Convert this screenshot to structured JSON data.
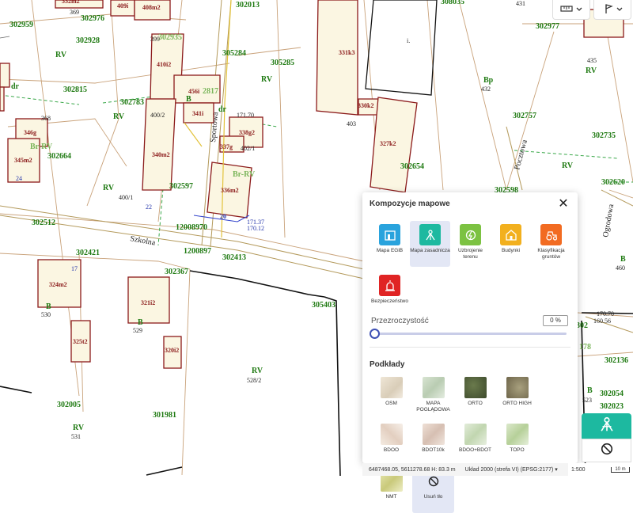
{
  "map": {
    "parcels": [
      "332m2",
      "409i",
      "408m2",
      "369",
      "302976",
      "302959",
      "302928",
      "399",
      "302935",
      "RV",
      "410i2",
      "302815",
      "302783",
      "456i",
      "2817",
      "341i",
      "400/2",
      "RV",
      "dr",
      "346g",
      "368",
      "Br-RV",
      "302664",
      "345m2",
      "340m2",
      "24",
      "RV",
      "400/1",
      "302597",
      "22",
      "302512",
      "12008970",
      "302421",
      "1200897",
      "302367",
      "324m2",
      "17",
      "321i2",
      "B",
      "B",
      "530",
      "529",
      "325t2",
      "320i2",
      "302005",
      "RV",
      "531",
      "301981",
      "RV",
      "528/2",
      "302413",
      "305403",
      "302013",
      "305284",
      "305285",
      "RV",
      "331k3",
      "i.",
      "330k2",
      "403",
      "327k2",
      "302654",
      "171.70",
      "338g2",
      "337g",
      "402/1",
      "336m2",
      "20",
      "Br-RV",
      "171.37",
      "170.12",
      "308035",
      "431",
      "302977",
      "435",
      "RV",
      "Bp",
      "432",
      "302757",
      "302735",
      "RV",
      "302598",
      "302620",
      "Ogrodowa",
      "Pocztowa",
      "B",
      "460",
      "170.70",
      "160.56",
      "302136",
      "302054",
      "302023",
      "B",
      "523",
      "178",
      "302",
      "dr",
      "B"
    ],
    "streets": {
      "szkolna": "Szkolna",
      "sportowa": "Sportowa",
      "pocztowa": "Pocztowa",
      "ogrodowa": "Ogrodowa"
    }
  },
  "toolbar": {
    "ruler_icon": "ruler-icon",
    "pin_icon": "pin-icon"
  },
  "panel": {
    "title": "Kompozycje mapowe",
    "compositions": [
      {
        "label": "Mapa EGiB",
        "color": "#29a3dd",
        "icon": "egib-icon"
      },
      {
        "label": "Mapa zasadnicza",
        "color": "#1db9a0",
        "icon": "surveyor-icon",
        "selected": true
      },
      {
        "label": "Uzbrojenie terenu",
        "color": "#7cc242",
        "icon": "utility-icon"
      },
      {
        "label": "Budynki",
        "color": "#f2b01e",
        "icon": "house-icon"
      },
      {
        "label": "Klasyfikacja gruntów",
        "color": "#f26b21",
        "icon": "tractor-icon"
      },
      {
        "label": "Bezpieczeństwo",
        "color": "#e02424",
        "icon": "alarm-icon"
      }
    ],
    "opacity_label": "Przezroczystość",
    "opacity_value": "0 %",
    "bg_title": "Podkłady",
    "backgrounds": [
      {
        "label": "OSM",
        "color": "#e6ddd0"
      },
      {
        "label": "MAPA POGLĄDOWA",
        "color": "#c9d9c2"
      },
      {
        "label": "ORTO",
        "color": "#4e5e3a"
      },
      {
        "label": "ORTO HIGH",
        "color": "#8a8060"
      },
      {
        "label": "BDOO",
        "color": "#efe3d8"
      },
      {
        "label": "BDOT10k",
        "color": "#e8d8cf"
      },
      {
        "label": "BDOO+BDOT",
        "color": "#d8e6cf"
      },
      {
        "label": "TOPO",
        "color": "#d2e3c0"
      },
      {
        "label": "NMT",
        "color": "#dce0a4"
      },
      {
        "label": "Usuń tło",
        "color": "#e3e7f5",
        "selected": true
      }
    ]
  },
  "status": {
    "coords": "6487468.05, 5611278.68 H: 83.3 m",
    "crs": "Układ 2000 (strefa VI) (EPSG:2177)",
    "chevron": "▾",
    "scale": "1:500",
    "scale_bar": "10 m"
  }
}
